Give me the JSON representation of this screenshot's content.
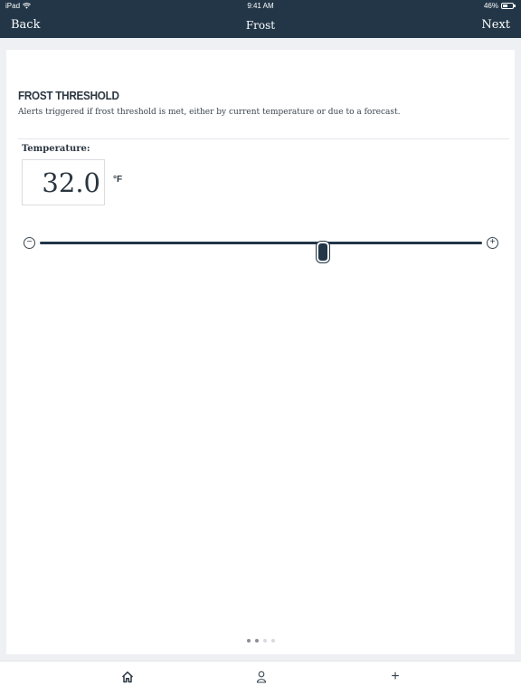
{
  "status": {
    "device": "iPad",
    "time": "9:41 AM",
    "battery": "46%"
  },
  "nav": {
    "back": "Back",
    "title": "Frost",
    "next": "Next"
  },
  "threshold": {
    "title": "FROST THRESHOLD",
    "description": "Alerts triggered if frost threshold is met, either by current temperature or due to a forecast."
  },
  "temperature": {
    "label": "Temperature:",
    "value": "32.0",
    "unit": "°F"
  },
  "slider": {
    "minus": "−",
    "plus": "+",
    "value_fraction": 0.64
  },
  "pager": {
    "count": 4,
    "active": 1
  },
  "tabs": {
    "add": "+"
  },
  "colors": {
    "navbar": "#223647",
    "text": "#2b3640",
    "background": "#eef0f3"
  }
}
